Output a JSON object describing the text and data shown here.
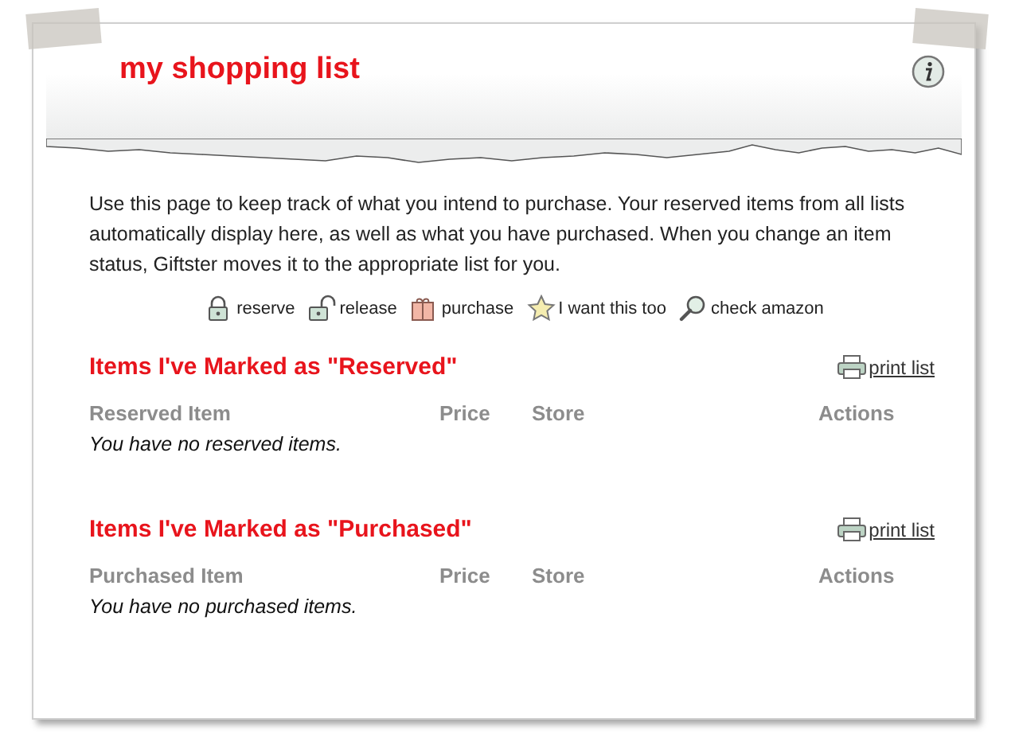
{
  "header": {
    "title": "my shopping list"
  },
  "intro": "Use this page to keep track of what you intend to purchase. Your reserved items from all lists automatically display here, as well as what you have purchased. When you change an item status, Giftster moves it to the appropriate list for you.",
  "legend": [
    {
      "kind": "lock",
      "label": "reserve"
    },
    {
      "kind": "unlock",
      "label": "release"
    },
    {
      "kind": "gift",
      "label": "purchase"
    },
    {
      "kind": "star",
      "label": "I want this too"
    },
    {
      "kind": "magnifier",
      "label": "check amazon"
    }
  ],
  "sections": [
    {
      "title": "Items I've Marked as \"Reserved\"",
      "print_link": "print list",
      "columns": [
        "Reserved Item",
        "Price",
        "Store",
        "Actions"
      ],
      "empty_message": "You have no reserved items."
    },
    {
      "title": "Items I've Marked as \"Purchased\"",
      "print_link": "print list",
      "columns": [
        "Purchased Item",
        "Price",
        "Store",
        "Actions"
      ],
      "empty_message": "You have no purchased items."
    }
  ]
}
